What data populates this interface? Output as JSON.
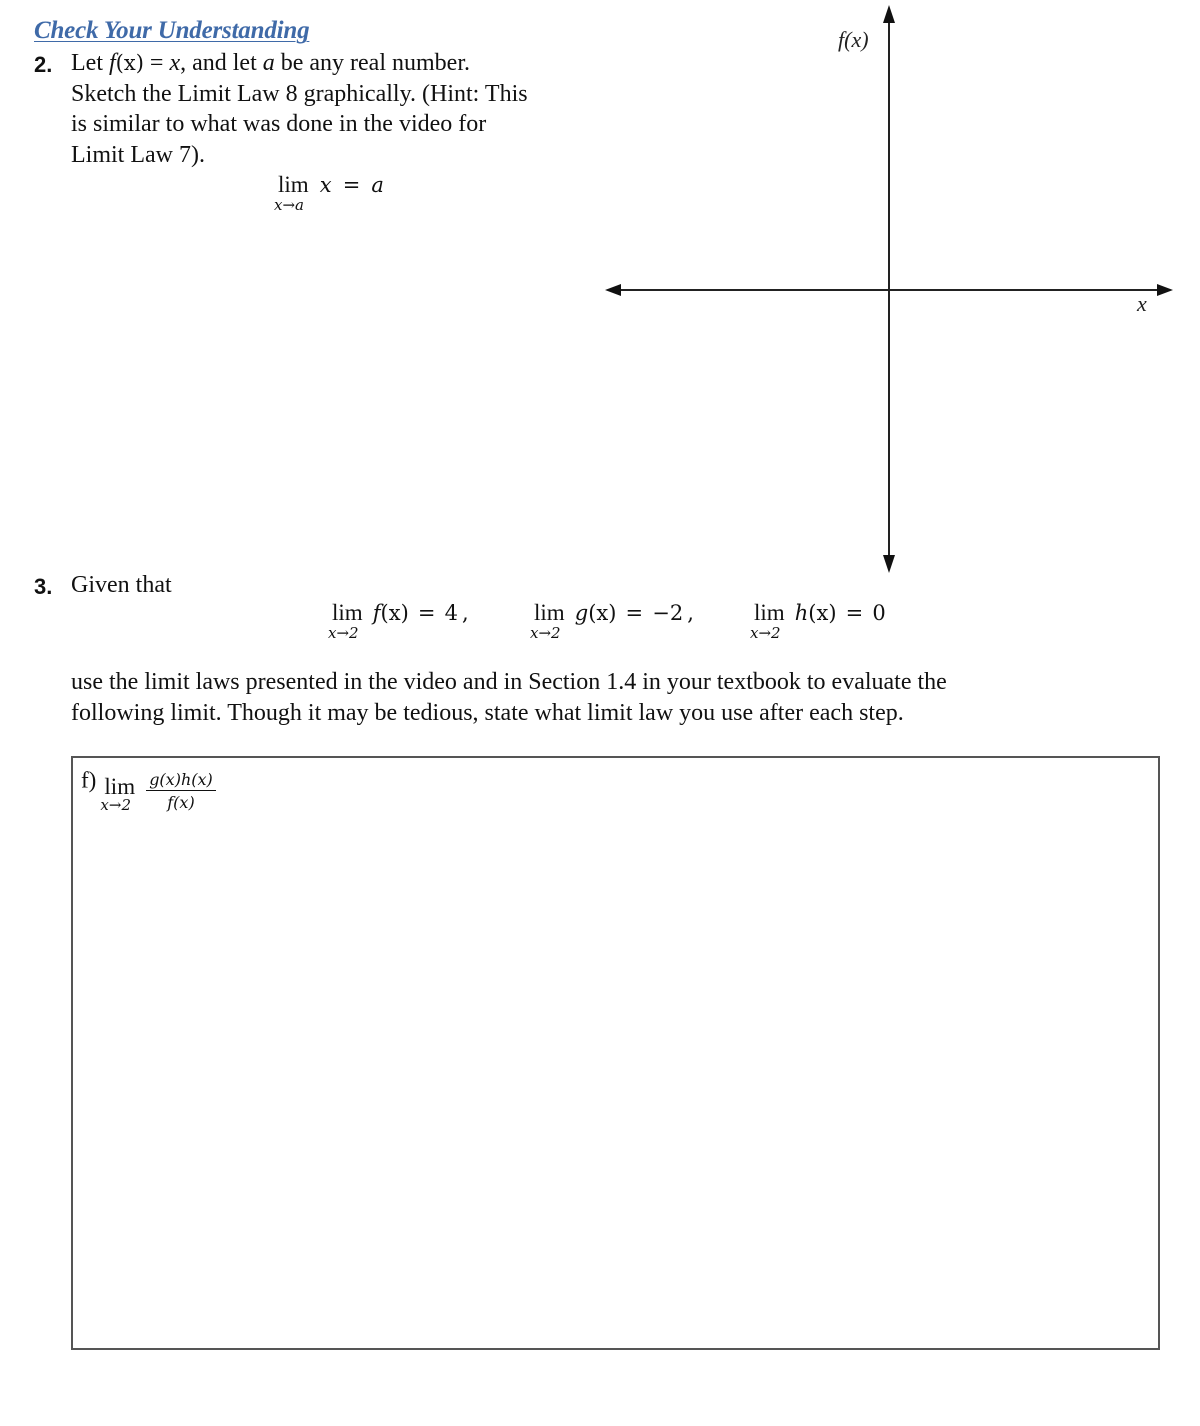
{
  "heading": "Check Your Understanding",
  "question2": {
    "number": "2.",
    "lines": [
      {
        "pre": "Let ",
        "f": "f",
        "fx": "(x)",
        "eq": " = ",
        "x": "x",
        "mid": ", and let ",
        "a": "a",
        "post": " be any real number."
      },
      "Sketch the Limit Law 8 graphically. (Hint: This",
      "is similar to what was done in the video for",
      "Limit Law 7)."
    ],
    "limit": {
      "lim": "lim",
      "sub_var": "x",
      "sub_arrow": "→",
      "sub_target": "a",
      "expr_var": "x",
      "eq": "=",
      "result": "a"
    },
    "graph": {
      "y_label": "f(x)",
      "x_label": "x"
    }
  },
  "question3": {
    "number": "3.",
    "intro": "Given that",
    "givens": [
      {
        "lim": "lim",
        "sub": "x→2",
        "fn": "f",
        "arg": "(x)",
        "eq": "=",
        "value": "4",
        "sep": ","
      },
      {
        "lim": "lim",
        "sub": "x→2",
        "fn": "g",
        "arg": "(x)",
        "eq": "=",
        "value": "−2",
        "sep": ","
      },
      {
        "lim": "lim",
        "sub": "x→2",
        "fn": "h",
        "arg": "(x)",
        "eq": "=",
        "value": "0",
        "sep": ""
      }
    ],
    "instructions": [
      "use the limit laws presented in the video and in Section 1.4 in your textbook to evaluate the",
      "following limit. Though it may be tedious, state what limit law you use after each step."
    ],
    "part": {
      "label": "f)",
      "lim": "lim",
      "sub": "x→2",
      "numerator": "g(x)h(x)",
      "denominator": "f(x)"
    }
  }
}
